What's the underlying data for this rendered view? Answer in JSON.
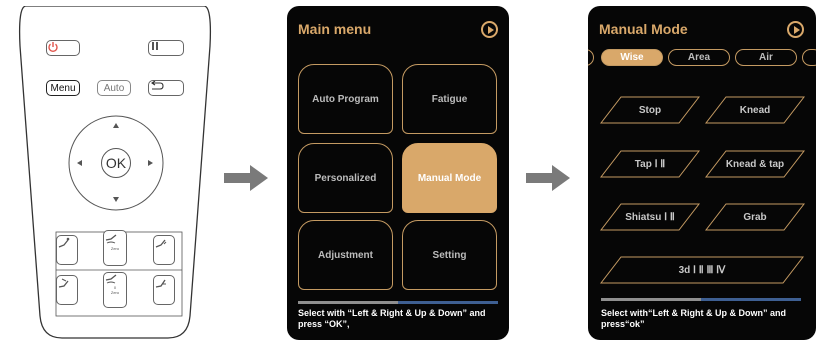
{
  "remote": {
    "menu_label": "Menu",
    "auto_label": "Auto",
    "ok_label": "OK",
    "zero_label_1": "Zero",
    "zero_label_2": "Zero",
    "zero_digit": "0"
  },
  "main_menu": {
    "title": "Main menu",
    "tiles": [
      {
        "label": "Auto Program"
      },
      {
        "label": "Fatigue"
      },
      {
        "label": "Personalized"
      },
      {
        "label": "Manual Mode"
      },
      {
        "label": "Adjustment"
      },
      {
        "label": "Setting"
      }
    ],
    "hint": "Select with “Left & Right & Up & Down” and press “OK”,"
  },
  "manual_mode": {
    "title": "Manual Mode",
    "tabs": [
      {
        "label": "Wise"
      },
      {
        "label": "Area"
      },
      {
        "label": "Air"
      }
    ],
    "buttons": [
      {
        "label": "Stop"
      },
      {
        "label": "Knead"
      },
      {
        "label": "Tap Ⅰ Ⅱ"
      },
      {
        "label": "Knead & tap"
      },
      {
        "label": "Shiatsu Ⅰ Ⅱ"
      },
      {
        "label": "Grab"
      },
      {
        "label": "3d Ⅰ Ⅱ Ⅲ Ⅳ"
      }
    ],
    "hint": "Select with“Left & Right & Up & Down” and press“ok”"
  },
  "colors": {
    "accent": "#d9a86a",
    "screen_bg": "#060606",
    "arrow": "#7a7a7a",
    "power": "#e0534a"
  },
  "icons": [
    "power-icon",
    "pause-icon",
    "back-icon",
    "play-icon",
    "chevron-up-icon",
    "chevron-down-icon",
    "chevron-left-icon",
    "chevron-right-icon",
    "recline-icon",
    "arrow-right-icon"
  ]
}
